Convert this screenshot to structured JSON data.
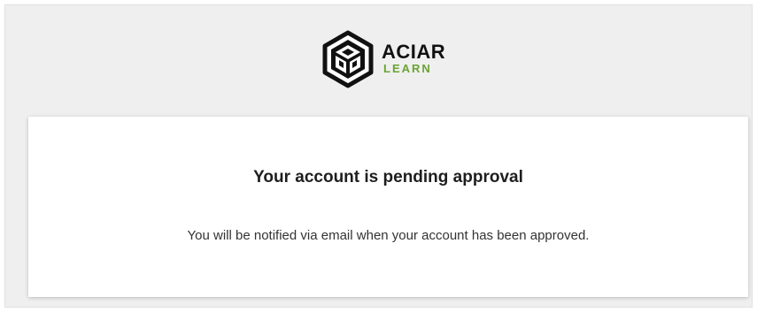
{
  "brand": {
    "name": "ACIAR",
    "sub": "LEARN",
    "logo_icon": "aciar-hexagon-logo-icon",
    "colors": {
      "name": "#111111",
      "sub": "#6aa333"
    }
  },
  "card": {
    "title": "Your account is pending approval",
    "message": "You will be notified via email when your account has been approved."
  },
  "colors": {
    "page_background": "#efefef",
    "card_background": "#ffffff"
  }
}
